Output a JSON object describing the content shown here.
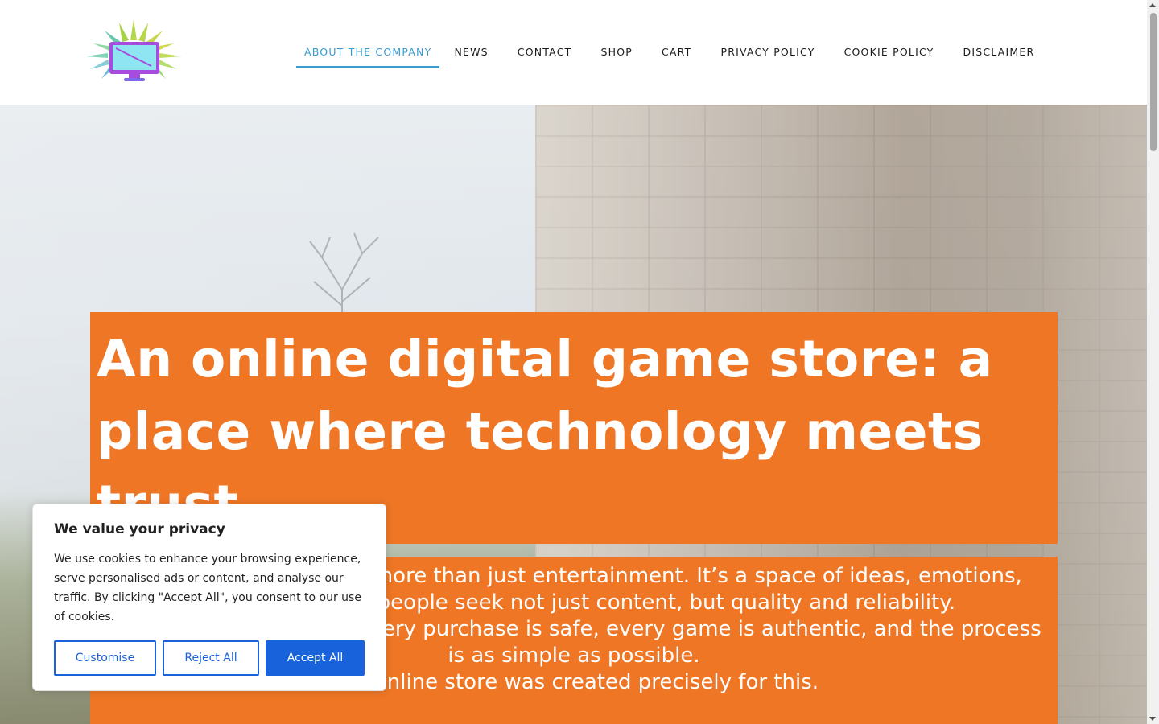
{
  "header": {
    "nav": [
      {
        "label": "ABOUT THE COMPANY"
      },
      {
        "label": "NEWS"
      },
      {
        "label": "CONTACT"
      },
      {
        "label": "SHOP"
      },
      {
        "label": "CART"
      },
      {
        "label": "PRIVACY POLICY"
      },
      {
        "label": "COOKIE POLICY"
      },
      {
        "label": "DISCLAIMER"
      }
    ],
    "active_index": 0,
    "active_color": "#3a9bd0",
    "logo_icon": "monitor-burst-logo"
  },
  "hero": {
    "title": "An online digital game store: a place where technology meets trust",
    "paragraphs": [
      "The gaming industry is more than just entertainment. It’s a space of ideas, emotions, where millions of people seek not just content, but quality and reliability.",
      "This is why confidence: every purchase is safe, every game is authentic, and the process is as simple as possible.",
      "Our online store was created precisely for this."
    ],
    "box_color": "#ee7625"
  },
  "cookie": {
    "title": "We value your privacy",
    "text": "We use cookies to enhance your browsing experience, serve personalised ads or content, and analyse our traffic. By clicking \"Accept All\", you consent to our use of cookies.",
    "customise_label": "Customise",
    "reject_label": "Reject All",
    "accept_label": "Accept All",
    "accent_color": "#1863dc"
  }
}
